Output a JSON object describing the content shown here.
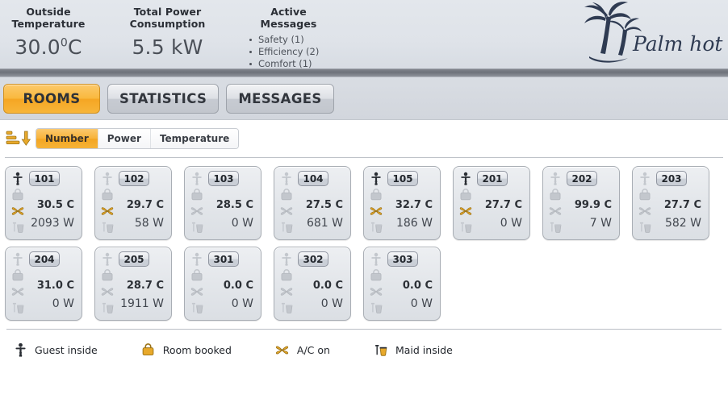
{
  "header": {
    "kpis": [
      {
        "name": "outside-temperature",
        "title_line1": "Outside",
        "title_line2": "Temperature",
        "value": "30.0",
        "sup": "0",
        "unit": "C"
      },
      {
        "name": "total-power-consumption",
        "title_line1": "Total Power",
        "title_line2": "Consumption",
        "value": "5.5 kW"
      },
      {
        "name": "active-messages",
        "title_line1": "Active",
        "title_line2": "Messages"
      }
    ],
    "messages": [
      {
        "label": "Safety (1)"
      },
      {
        "label": "Efficiency (2)"
      },
      {
        "label": "Comfort (1)"
      }
    ],
    "logo_text": "Palm hotel"
  },
  "tabs": [
    {
      "label": "ROOMS",
      "active": true
    },
    {
      "label": "STATISTICS",
      "active": false
    },
    {
      "label": "MESSAGES",
      "active": false
    }
  ],
  "filter": {
    "sort_icon": "sort-descending-icon",
    "options": [
      {
        "label": "Number",
        "active": true
      },
      {
        "label": "Power",
        "active": false
      },
      {
        "label": "Temperature",
        "active": false
      }
    ]
  },
  "rooms": [
    {
      "number": "101",
      "temp": "30.5 C",
      "power": "2093 W",
      "guest": true,
      "booked": false,
      "ac": true,
      "maid": false
    },
    {
      "number": "102",
      "temp": "29.7 C",
      "power": "58 W",
      "guest": false,
      "booked": false,
      "ac": true,
      "maid": false
    },
    {
      "number": "103",
      "temp": "28.5 C",
      "power": "0 W",
      "guest": false,
      "booked": false,
      "ac": false,
      "maid": false
    },
    {
      "number": "104",
      "temp": "27.5 C",
      "power": "681 W",
      "guest": false,
      "booked": false,
      "ac": false,
      "maid": false
    },
    {
      "number": "105",
      "temp": "32.7 C",
      "power": "186 W",
      "guest": true,
      "booked": false,
      "ac": true,
      "maid": false
    },
    {
      "number": "201",
      "temp": "27.7 C",
      "power": "0 W",
      "guest": true,
      "booked": false,
      "ac": true,
      "maid": false
    },
    {
      "number": "202",
      "temp": "99.9 C",
      "power": "7 W",
      "guest": false,
      "booked": false,
      "ac": false,
      "maid": false
    },
    {
      "number": "203",
      "temp": "27.7 C",
      "power": "582 W",
      "guest": false,
      "booked": false,
      "ac": false,
      "maid": false
    },
    {
      "number": "204",
      "temp": "31.0 C",
      "power": "0 W",
      "guest": false,
      "booked": false,
      "ac": false,
      "maid": false
    },
    {
      "number": "205",
      "temp": "28.7 C",
      "power": "1911 W",
      "guest": false,
      "booked": false,
      "ac": false,
      "maid": false
    },
    {
      "number": "301",
      "temp": "0.0 C",
      "power": "0 W",
      "guest": false,
      "booked": false,
      "ac": false,
      "maid": false
    },
    {
      "number": "302",
      "temp": "0.0 C",
      "power": "0 W",
      "guest": false,
      "booked": false,
      "ac": false,
      "maid": false
    },
    {
      "number": "303",
      "temp": "0.0 C",
      "power": "0 W",
      "guest": false,
      "booked": false,
      "ac": false,
      "maid": false
    }
  ],
  "legend": [
    {
      "icon": "guest-icon",
      "label": "Guest inside"
    },
    {
      "icon": "booked-icon",
      "label": "Room booked"
    },
    {
      "icon": "ac-icon",
      "label": "A/C on"
    },
    {
      "icon": "maid-icon",
      "label": "Maid inside"
    }
  ],
  "colors": {
    "accent": "#f5a623",
    "accent_dark": "#d09122",
    "icon_on": "#e8a92b",
    "icon_off": "#c3c7cd",
    "header_bg": "#dfe3e9",
    "text": "#2c3036"
  }
}
